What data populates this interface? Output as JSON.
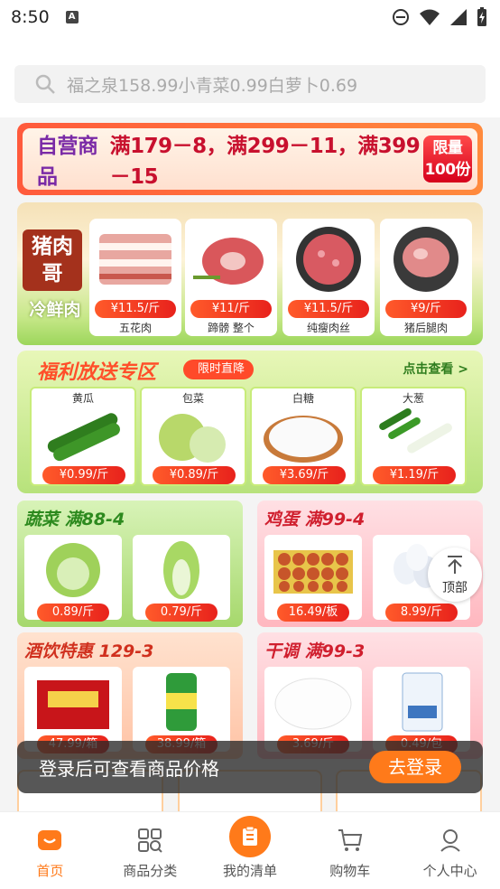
{
  "status": {
    "time": "8:50"
  },
  "search": {
    "placeholder": "福之泉158.99小青菜0.99白萝卜0.69"
  },
  "banner": {
    "prefix": "自营商品",
    "text": "满179－8，满299－11，满399－15",
    "badge_line1": "限量",
    "badge_line2": "100份"
  },
  "pork": {
    "brand_line1": "猪肉",
    "brand_line2": "哥",
    "brand_sub": "冷鲜肉",
    "items": [
      {
        "price": "¥11.5/斤",
        "name": "五花肉"
      },
      {
        "price": "¥11/斤",
        "name": "蹄髈 整个"
      },
      {
        "price": "¥11.5/斤",
        "name": "纯瘦肉丝"
      },
      {
        "price": "¥9/斤",
        "name": "猪后腿肉"
      }
    ]
  },
  "welfare": {
    "title": "福利放送专区",
    "tag": "限时直降",
    "more": "点击查看 >",
    "items": [
      {
        "name": "黄瓜",
        "price": "¥0.99/斤"
      },
      {
        "name": "包菜",
        "price": "¥0.89/斤"
      },
      {
        "name": "白糖",
        "price": "¥3.69/斤"
      },
      {
        "name": "大葱",
        "price": "¥1.19/斤"
      }
    ]
  },
  "categories": {
    "veg": {
      "title": "蔬菜 满88-4",
      "prices": [
        "0.89/斤",
        "0.79/斤"
      ]
    },
    "egg": {
      "title": "鸡蛋 满99-4",
      "prices": [
        "16.49/板",
        "8.99/斤"
      ]
    },
    "drink": {
      "title": "酒饮特惠 129-3",
      "prices": [
        "47.99/箱",
        "38.99/箱"
      ]
    },
    "dry": {
      "title": "干调 满99-3",
      "prices": [
        "3.69/斤",
        "0.49/包"
      ]
    }
  },
  "to_top": "顶部",
  "login_bar": {
    "text": "登录后可查看商品价格",
    "button": "去登录"
  },
  "tabs": [
    {
      "label": "首页"
    },
    {
      "label": "商品分类"
    },
    {
      "label": "我的清单"
    },
    {
      "label": "购物车"
    },
    {
      "label": "个人中心"
    }
  ],
  "colors": {
    "accent": "#ff7a1a",
    "price_red": "#e8221c"
  }
}
